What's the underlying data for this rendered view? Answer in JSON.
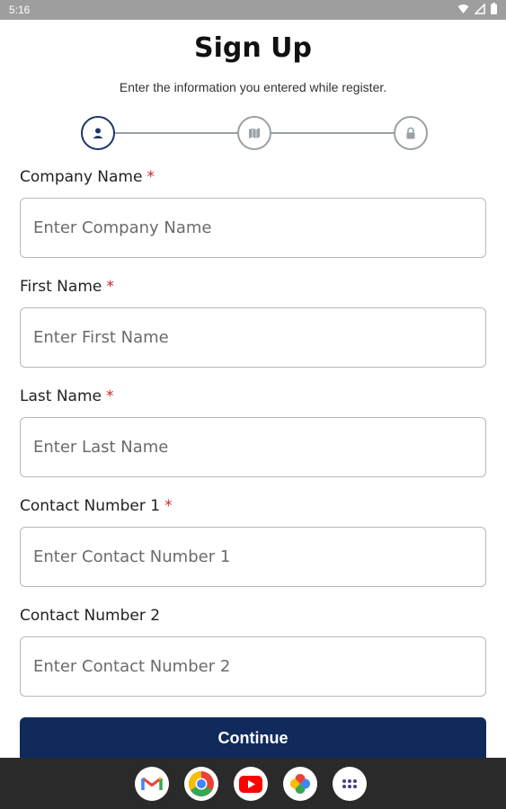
{
  "status_bar": {
    "time": "5:16"
  },
  "header": {
    "title": "Sign Up",
    "subtitle": "Enter the information you entered while register."
  },
  "stepper": {
    "steps": [
      {
        "icon": "person-icon",
        "state": "active"
      },
      {
        "icon": "map-icon",
        "state": "inactive"
      },
      {
        "icon": "lock-icon",
        "state": "inactive"
      }
    ],
    "active_color": "#1d3566",
    "inactive_color": "#9aa0a6"
  },
  "form": {
    "company_name": {
      "label": "Company Name",
      "required_mark": "*",
      "value": "",
      "placeholder": "Enter Company Name"
    },
    "first_name": {
      "label": "First Name",
      "required_mark": "*",
      "value": "",
      "placeholder": "Enter First Name"
    },
    "last_name": {
      "label": "Last Name",
      "required_mark": "*",
      "value": "",
      "placeholder": "Enter Last Name"
    },
    "contact_number_1": {
      "label": "Contact Number 1",
      "required_mark": "*",
      "value": "",
      "placeholder": "Enter Contact Number 1"
    },
    "contact_number_2": {
      "label": "Contact Number 2",
      "value": "",
      "placeholder": "Enter Contact Number 2"
    }
  },
  "actions": {
    "continue_label": "Continue"
  },
  "colors": {
    "primary": "#102a5b",
    "required": "#c62828"
  },
  "dock": {
    "apps": [
      "gmail-icon",
      "chrome-icon",
      "youtube-icon",
      "photos-icon",
      "app-drawer-icon"
    ]
  }
}
